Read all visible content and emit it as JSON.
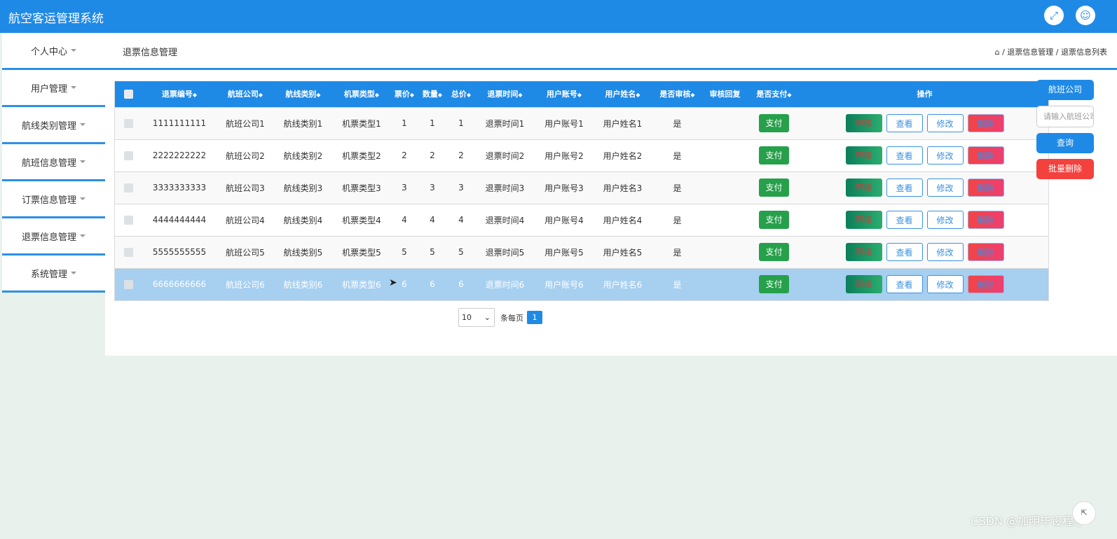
{
  "header": {
    "title": "航空客运管理系统",
    "fullscreen_icon": "fullscreen-icon",
    "user_icon": "user-icon"
  },
  "sidebar": {
    "items": [
      {
        "label": "个人中心"
      },
      {
        "label": "用户管理"
      },
      {
        "label": "航线类别管理"
      },
      {
        "label": "航班信息管理"
      },
      {
        "label": "订票信息管理"
      },
      {
        "label": "退票信息管理"
      },
      {
        "label": "系统管理"
      }
    ]
  },
  "breadcrumb": {
    "page_title": "退票信息管理",
    "home_icon": "home-icon",
    "path": "/ 退票信息管理 / 退票信息列表"
  },
  "table": {
    "headers": [
      "退票编号",
      "航班公司",
      "航线类别",
      "机票类型",
      "票价",
      "数量",
      "总价",
      "退票时间",
      "用户账号",
      "用户姓名",
      "是否审核",
      "审核回复",
      "是否支付",
      "操作"
    ],
    "rows": [
      {
        "no": "1111111111",
        "company": "航班公司1",
        "route": "航线类别1",
        "ticket_type": "机票类型1",
        "price": "1",
        "qty": "1",
        "total": "1",
        "refund_time": "退票时间1",
        "account": "用户账号1",
        "name": "用户姓名1",
        "audited": "是",
        "reply": ""
      },
      {
        "no": "2222222222",
        "company": "航班公司2",
        "route": "航线类别2",
        "ticket_type": "机票类型2",
        "price": "2",
        "qty": "2",
        "total": "2",
        "refund_time": "退票时间2",
        "account": "用户账号2",
        "name": "用户姓名2",
        "audited": "是",
        "reply": ""
      },
      {
        "no": "3333333333",
        "company": "航班公司3",
        "route": "航线类别3",
        "ticket_type": "机票类型3",
        "price": "3",
        "qty": "3",
        "total": "3",
        "refund_time": "退票时间3",
        "account": "用户账号3",
        "name": "用户姓名3",
        "audited": "是",
        "reply": ""
      },
      {
        "no": "4444444444",
        "company": "航班公司4",
        "route": "航线类别4",
        "ticket_type": "机票类型4",
        "price": "4",
        "qty": "4",
        "total": "4",
        "refund_time": "退票时间4",
        "account": "用户账号4",
        "name": "用户姓名4",
        "audited": "是",
        "reply": ""
      },
      {
        "no": "5555555555",
        "company": "航班公司5",
        "route": "航线类别5",
        "ticket_type": "机票类型5",
        "price": "5",
        "qty": "5",
        "total": "5",
        "refund_time": "退票时间5",
        "account": "用户账号5",
        "name": "用户姓名5",
        "audited": "是",
        "reply": ""
      },
      {
        "no": "6666666666",
        "company": "航班公司6",
        "route": "航线类别6",
        "ticket_type": "机票类型6",
        "price": "6",
        "qty": "6",
        "total": "6",
        "refund_time": "退票时间6",
        "account": "用户账号6",
        "name": "用户姓名6",
        "audited": "是",
        "reply": ""
      }
    ],
    "actions": {
      "pay": "支付",
      "audit": "审核",
      "view": "查看",
      "edit": "修改",
      "delete": "删除"
    }
  },
  "pagination": {
    "page_size": "10",
    "per_page_label": "条每页",
    "current_page": "1"
  },
  "search_panel": {
    "field_label": "航班公司",
    "placeholder": "请输入航班公司",
    "query_button": "查询",
    "batch_delete_button": "批量删除"
  },
  "watermark": "CSDN @加明毕设程序",
  "colors": {
    "primary": "#1f8ae6",
    "success": "#26a04a",
    "danger": "#f3413d",
    "row_highlight": "#a6cff0"
  }
}
